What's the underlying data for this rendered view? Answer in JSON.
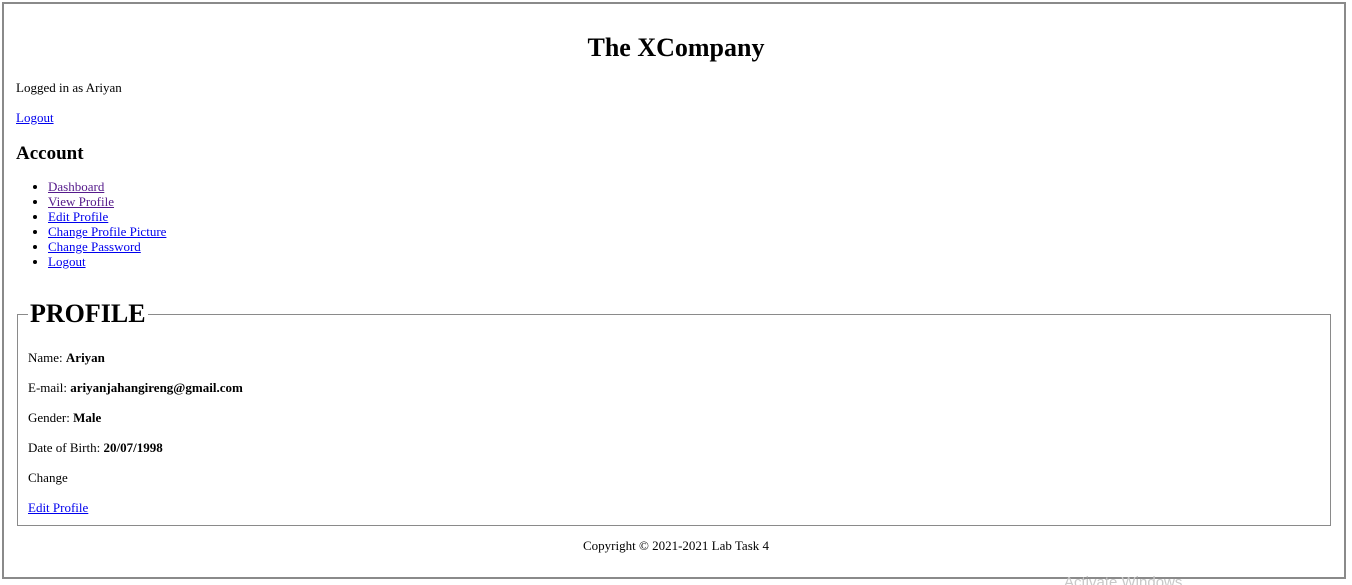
{
  "header": {
    "title": "The XCompany",
    "logged_in_text": "Logged in as Ariyan",
    "logout_label": "Logout"
  },
  "account": {
    "heading": "Account",
    "menu": [
      {
        "label": "Dashboard",
        "visited": true
      },
      {
        "label": "View Profile",
        "visited": true
      },
      {
        "label": "Edit Profile",
        "visited": false
      },
      {
        "label": "Change Profile Picture",
        "visited": false
      },
      {
        "label": "Change Password",
        "visited": false
      },
      {
        "label": "Logout",
        "visited": false
      }
    ]
  },
  "profile": {
    "legend": "PROFILE",
    "name_label": "Name:",
    "name_value": "Ariyan",
    "email_label": "E-mail:",
    "email_value": "ariyanjahangireng@gmail.com",
    "gender_label": "Gender:",
    "gender_value": "Male",
    "dob_label": "Date of Birth:",
    "dob_value": "20/07/1998",
    "change_text": "Change",
    "edit_link": "Edit Profile"
  },
  "footer": {
    "copyright": "Copyright © 2021-2021 Lab Task 4"
  },
  "overlay": {
    "watermark": "Activate Windows"
  },
  "colors": {
    "link": "#0000ee",
    "visited_link": "#551a8b",
    "border": "#8a8a8a"
  }
}
